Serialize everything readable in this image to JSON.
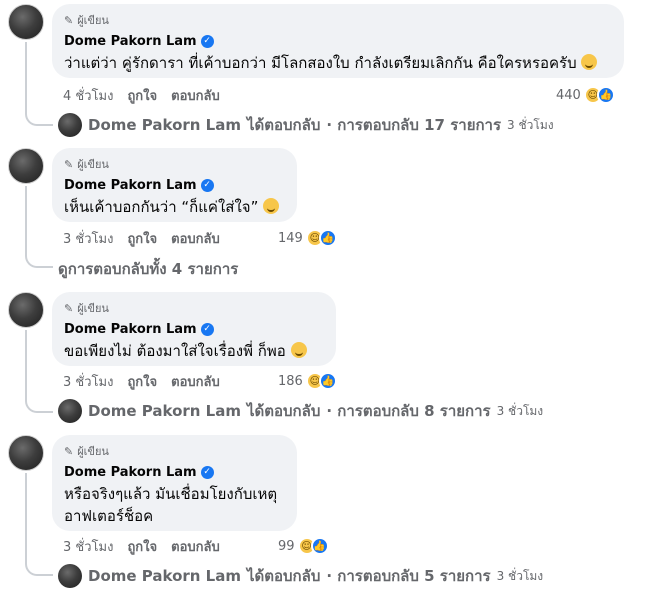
{
  "author_tag": "ผู้เขียน",
  "comments": [
    {
      "author": "Dome Pakorn Lam",
      "text": "ว่าแต่ว่า คู่รักดารา ที่เค้าบอกว่า มีโลกสองใบ กำลังเตรียมเลิกกัน คือใครหรอครับ",
      "time": "4 ชั่วโมง",
      "like": "ถูกใจ",
      "reply": "ตอบกลับ",
      "reaction_count": "440",
      "reply_summary": {
        "name": "Dome Pakorn Lam",
        "action": "ได้ตอบกลับ",
        "count_text": "· การตอบกลับ 17 รายการ",
        "time": "3 ชั่วโมง"
      }
    },
    {
      "author": "Dome Pakorn Lam",
      "text": "เห็นเค้าบอกกันว่า “ก็แค่ใส่ใจ”",
      "time": "3 ชั่วโมง",
      "like": "ถูกใจ",
      "reply": "ตอบกลับ",
      "reaction_count": "149",
      "view_replies": "ดูการตอบกลับทั้ง 4 รายการ"
    },
    {
      "author": "Dome Pakorn Lam",
      "text": "ขอเพียงไม่ ต้องมาใส่ใจเรื่องพี่ ก็พอ",
      "time": "3 ชั่วโมง",
      "like": "ถูกใจ",
      "reply": "ตอบกลับ",
      "reaction_count": "186",
      "reply_summary": {
        "name": "Dome Pakorn Lam",
        "action": "ได้ตอบกลับ",
        "count_text": "· การตอบกลับ 8 รายการ",
        "time": "3 ชั่วโมง"
      }
    },
    {
      "author": "Dome Pakorn Lam",
      "text_line1": "หรือจริงๆแล้ว มันเชื่อมโยงกับเหตุ",
      "text_line2": "อาฟเตอร์ช็อค",
      "time": "3 ชั่วโมง",
      "like": "ถูกใจ",
      "reply": "ตอบกลับ",
      "reaction_count": "99",
      "reply_summary": {
        "name": "Dome Pakorn Lam",
        "action": "ได้ตอบกลับ",
        "count_text": "· การตอบกลับ 5 รายการ",
        "time": "3 ชั่วโมง"
      }
    }
  ],
  "colors": {
    "bubble": "#f0f2f5",
    "meta_text": "#65676b",
    "verified": "#1877f2",
    "haha": "#f7c64a",
    "like": "#1877f2"
  },
  "icons": [
    "pen-icon",
    "verified-badge-icon",
    "emoji-icon",
    "haha-reaction-icon",
    "like-reaction-icon"
  ]
}
